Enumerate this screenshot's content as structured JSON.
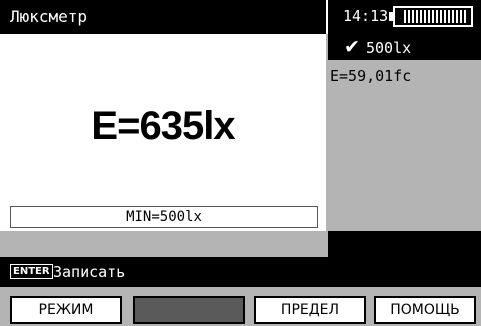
{
  "header": {
    "title": "Люксметр",
    "time": "14:13",
    "battery_icon": "battery-full-icon"
  },
  "main": {
    "reading": "E=635lx",
    "min_label": "MIN=500lx"
  },
  "right_panel": {
    "check_icon": "check-icon",
    "limit_value": "500lx",
    "fc_value": "E=59,01fc"
  },
  "hint": {
    "key_label": "ENTER",
    "text": "Записать"
  },
  "softkeys": {
    "mode": "РЕЖИМ",
    "blank": "",
    "limit": "ПРЕДЕЛ",
    "help": "ПОМОЩЬ"
  },
  "colors": {
    "background": "#b4b4b4",
    "bar": "#000000",
    "panel": "#ffffff",
    "disabled_key": "#5a5a5a"
  }
}
